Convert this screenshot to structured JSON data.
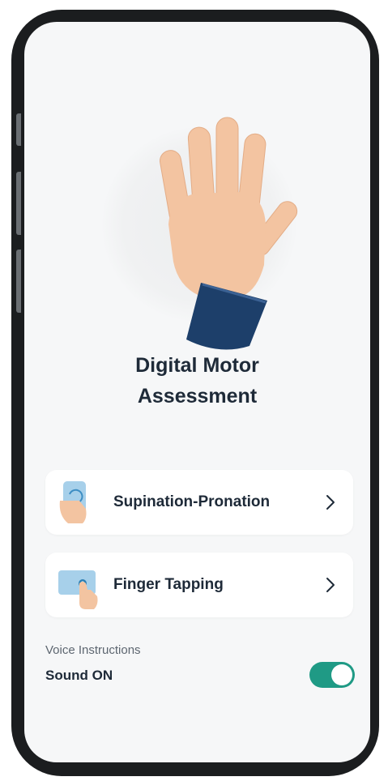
{
  "screen": {
    "title_line1": "Digital Motor",
    "title_line2": "Assessment"
  },
  "options": [
    {
      "label": "Supination-Pronation",
      "icon": "phone-rotate-icon"
    },
    {
      "label": "Finger Tapping",
      "icon": "finger-tap-icon"
    }
  ],
  "voice": {
    "section_label": "Voice Instructions",
    "status_label": "Sound ON",
    "toggle_on": true
  },
  "colors": {
    "accent": "#1f9a85",
    "text": "#1e2a38",
    "sleeve": "#1d3f6a",
    "skin": "#f3c4a1"
  }
}
